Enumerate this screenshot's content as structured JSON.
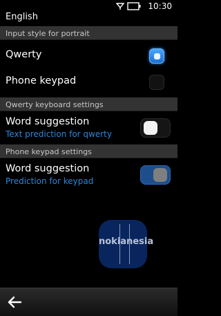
{
  "status": {
    "time": "10:30"
  },
  "page_title": "English",
  "sections": [
    {
      "header": "Input style for portrait",
      "items": [
        {
          "label": "Qwerty",
          "selected": true
        },
        {
          "label": "Phone keypad",
          "selected": false
        }
      ]
    },
    {
      "header": "Qwerty keyboard settings",
      "items": [
        {
          "label": "Word suggestion",
          "sublabel": "Text prediction for qwerty",
          "toggle": "off"
        }
      ]
    },
    {
      "header": "Phone keypad settings",
      "items": [
        {
          "label": "Word suggestion",
          "sublabel": "Prediction for keypad",
          "toggle": "on"
        }
      ]
    }
  ],
  "watermark": "nokianesia",
  "colors": {
    "accent": "#2c86d9",
    "header_bg": "#333333",
    "background": "#000000"
  },
  "icons": [
    "signal-icon",
    "battery-icon",
    "back-arrow-icon"
  ]
}
